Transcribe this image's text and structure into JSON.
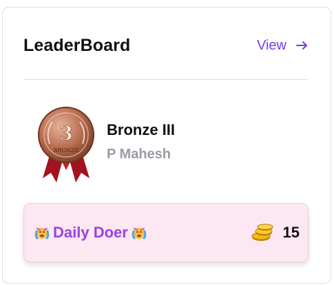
{
  "header": {
    "title": "LeaderBoard",
    "view_label": "View"
  },
  "rank": {
    "tier": "Bronze III",
    "user": "P Mahesh",
    "medal_number": "3",
    "medal_text": "BRONZE"
  },
  "badge": {
    "label": "Daily Doer",
    "coins": "15"
  },
  "colors": {
    "accent": "#7c3aed",
    "badge_bg": "#fce7f3",
    "badge_text": "#9b40e6",
    "muted": "#9b9ba6"
  }
}
